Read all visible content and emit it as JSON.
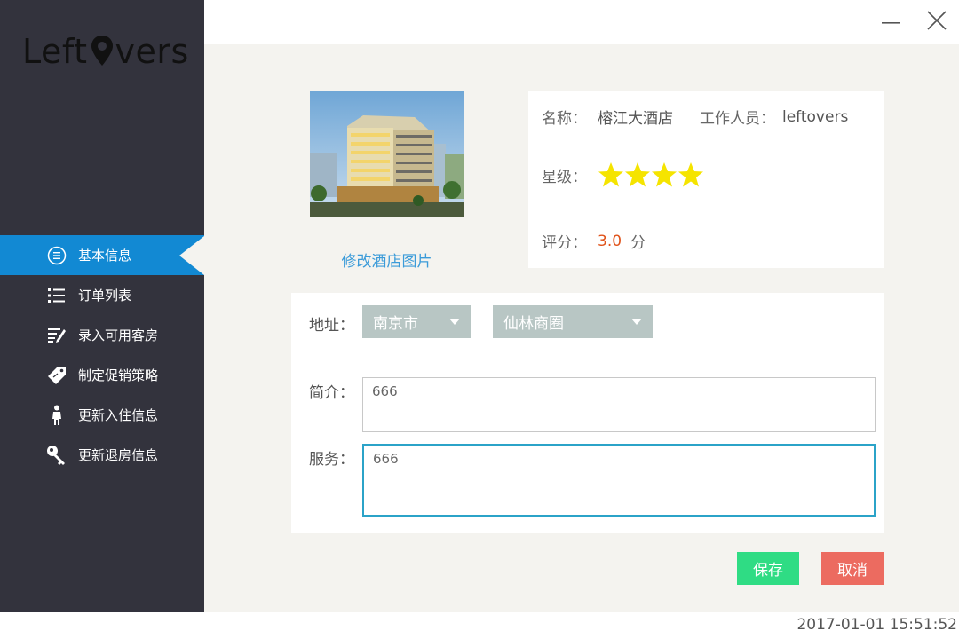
{
  "app": {
    "logo_text_left": "Left",
    "logo_text_right": "vers"
  },
  "sidebar": {
    "items": [
      {
        "label": "基本信息",
        "icon": "list-circle-icon",
        "active": true
      },
      {
        "label": "订单列表",
        "icon": "list-icon",
        "active": false
      },
      {
        "label": "录入可用客房",
        "icon": "edit-list-icon",
        "active": false
      },
      {
        "label": "制定促销策略",
        "icon": "tag-icon",
        "active": false
      },
      {
        "label": "更新入住信息",
        "icon": "person-icon",
        "active": false
      },
      {
        "label": "更新退房信息",
        "icon": "key-icon",
        "active": false
      }
    ]
  },
  "window": {
    "minimize_icon": "minimize-icon",
    "close_icon": "close-icon"
  },
  "hotel": {
    "edit_image_link": "修改酒店图片",
    "name_label": "名称：",
    "name_value": "榕江大酒店",
    "staff_label": "工作人员：",
    "staff_value": "leftovers",
    "star_label": "星级：",
    "star_count": 4,
    "rating_label": "评分：",
    "rating_value": "3.0",
    "rating_unit": "分"
  },
  "form": {
    "address_label": "地址：",
    "city_value": "南京市",
    "district_value": "仙林商圈",
    "intro_label": "简介：",
    "intro_value": "666",
    "service_label": "服务：",
    "service_value": "666"
  },
  "actions": {
    "save_label": "保存",
    "cancel_label": "取消"
  },
  "status": {
    "timestamp": "2017-01-01 15:51:52"
  },
  "colors": {
    "sidebar_bg": "#33333d",
    "active_item": "#1289d3",
    "save_button": "#2fdc84",
    "cancel_button": "#ec6b60",
    "star": "#f5e400",
    "rating": "#e0531b"
  }
}
